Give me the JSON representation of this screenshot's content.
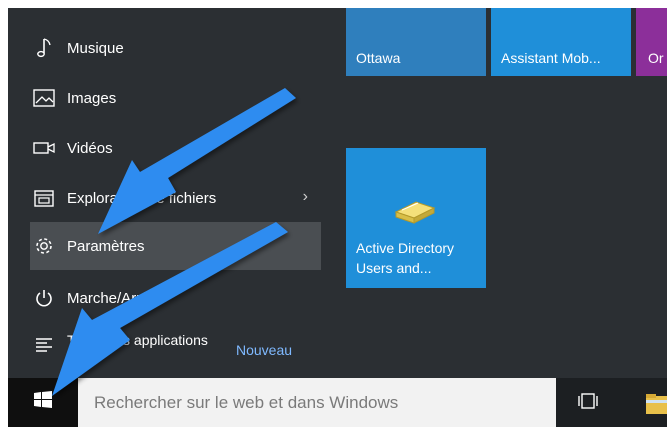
{
  "start_menu": {
    "items": [
      {
        "label": "Musique",
        "icon": "music-note-icon"
      },
      {
        "label": "Images",
        "icon": "image-icon"
      },
      {
        "label": "Vidéos",
        "icon": "video-camera-icon"
      },
      {
        "label": "Explorateur de fichiers",
        "icon": "file-explorer-icon"
      },
      {
        "label": "Paramètres",
        "icon": "gear-icon"
      },
      {
        "label": "Marche/Arrêt",
        "icon": "power-icon"
      },
      {
        "label": "Toutes les applications",
        "icon": "list-icon"
      }
    ],
    "new_badge": "Nouveau"
  },
  "tiles": {
    "ottawa": "Ottawa",
    "assistant": "Assistant Mob...",
    "partial": "Or",
    "active_directory": "Active Directory Users and..."
  },
  "taskbar": {
    "search_placeholder": "Rechercher sur le web et dans Windows",
    "start_icon": "windows-logo-icon",
    "task_view_icon": "task-view-icon"
  },
  "colors": {
    "menu_bg": "#2b2f33",
    "highlight": "#4a4e52",
    "tile_blue": "#1f8fd9",
    "tile_purple": "#8c2f9a",
    "arrow_blue": "#2d8cf0",
    "new_badge": "#7fb9ff"
  }
}
